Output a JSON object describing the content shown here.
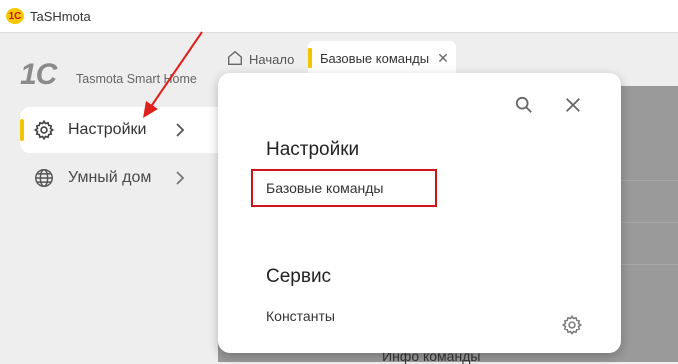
{
  "window": {
    "title": "TaSHmota",
    "logo_text": "1С"
  },
  "brand": {
    "logo": "1С",
    "name": "Tasmota Smart Home"
  },
  "sidebar": {
    "items": [
      {
        "label": "Настройки",
        "icon": "gear-icon",
        "active": true
      },
      {
        "label": "Умный дом",
        "icon": "globe-icon",
        "active": false
      }
    ]
  },
  "tabs": [
    {
      "label": "Начало",
      "icon": "home-icon"
    },
    {
      "label": "Базовые команды",
      "active": true
    }
  ],
  "panel": {
    "sections": [
      {
        "title": "Настройки",
        "items": [
          "Базовые команды"
        ]
      },
      {
        "title": "Сервис",
        "items": [
          "Константы"
        ]
      }
    ]
  },
  "background": {
    "row_text": "Инфо команды"
  },
  "colors": {
    "accent_yellow": "#f2c400",
    "highlight_red": "#d0131b",
    "arrow_red": "#e0201c"
  }
}
